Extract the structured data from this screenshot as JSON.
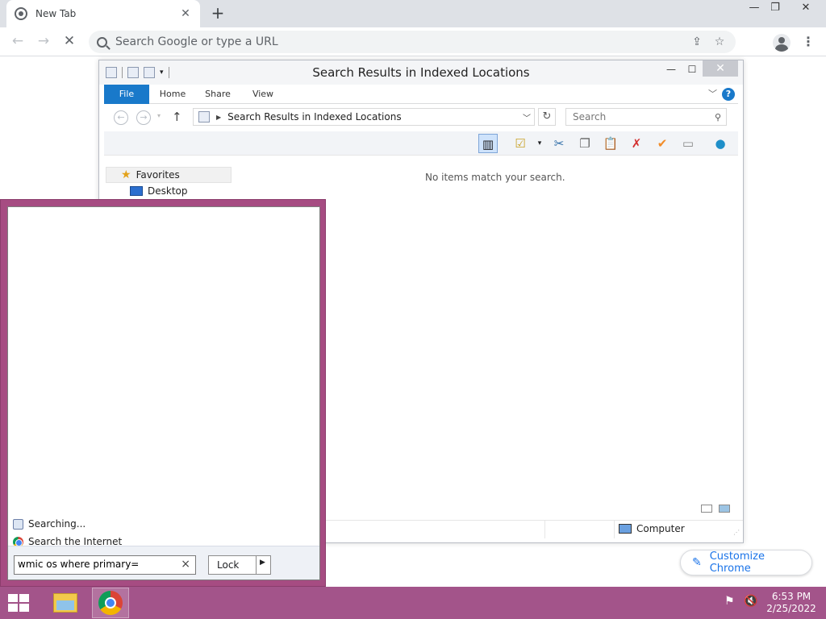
{
  "browser": {
    "tab_title": "New Tab",
    "tab_close": "✕",
    "new_tab": "+",
    "omnibox_placeholder": "Search Google or type a URL",
    "window_controls": {
      "minimize": "—",
      "restore": "❐",
      "close": "✕"
    },
    "customize_label": "Customize Chrome"
  },
  "explorer": {
    "title": "Search Results in Indexed Locations",
    "ribbon_tabs": [
      "File",
      "Home",
      "Share",
      "View"
    ],
    "address": "Search Results in Indexed Locations",
    "search_placeholder": "Search",
    "nav": {
      "favorites": "Favorites",
      "desktop": "Desktop"
    },
    "empty_message": "No items match your search.",
    "status_location": "Computer"
  },
  "start_menu": {
    "results": [
      {
        "label": "Searching...",
        "icon": "search-icon"
      },
      {
        "label": "Search the Internet",
        "icon": "chrome-icon"
      }
    ],
    "search_value": "wmic os where primary=",
    "power_button": "Lock"
  },
  "taskbar": {
    "time": "6:53 PM",
    "date": "2/25/2022"
  },
  "colors": {
    "start_menu_border": "#a64c82",
    "taskbar": "#a3548a",
    "ribbon_file": "#1979ca",
    "customize_text": "#1a73e8"
  }
}
